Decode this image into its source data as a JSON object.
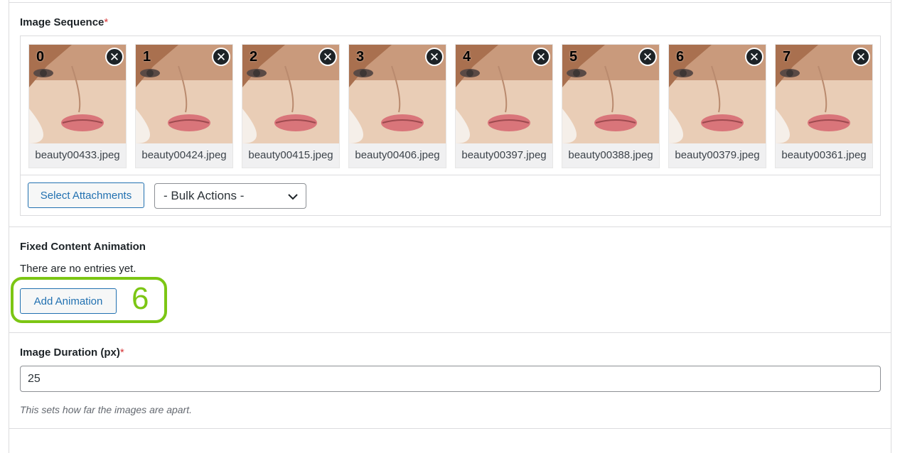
{
  "image_sequence": {
    "label": "Image Sequence",
    "required_mark": "*",
    "items": [
      {
        "index": "0",
        "filename": "beauty00433.jpeg",
        "remove_icon": "close-icon"
      },
      {
        "index": "1",
        "filename": "beauty00424.jpeg",
        "remove_icon": "close-icon"
      },
      {
        "index": "2",
        "filename": "beauty00415.jpeg",
        "remove_icon": "close-icon"
      },
      {
        "index": "3",
        "filename": "beauty00406.jpeg",
        "remove_icon": "close-icon"
      },
      {
        "index": "4",
        "filename": "beauty00397.jpeg",
        "remove_icon": "close-icon"
      },
      {
        "index": "5",
        "filename": "beauty00388.jpeg",
        "remove_icon": "close-icon"
      },
      {
        "index": "6",
        "filename": "beauty00379.jpeg",
        "remove_icon": "close-icon"
      },
      {
        "index": "7",
        "filename": "beauty00361.jpeg",
        "remove_icon": "close-icon"
      }
    ],
    "select_button": "Select Attachments",
    "bulk_actions": {
      "selected": "- Bulk Actions -"
    }
  },
  "fixed_content_animation": {
    "label": "Fixed Content Animation",
    "empty_text": "There are no entries yet.",
    "add_button": "Add Animation",
    "step_marker": "6",
    "highlight_color": "#7cc614"
  },
  "image_duration": {
    "label": "Image Duration (px)",
    "required_mark": "*",
    "value": "25",
    "description": "This sets how far the images are apart."
  },
  "colors": {
    "accent": "#2271b1",
    "required": "#d63638",
    "border": "#dcdcde"
  }
}
